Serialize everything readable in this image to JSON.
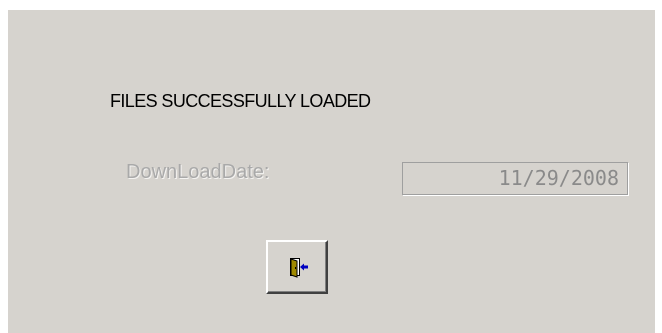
{
  "dialog": {
    "status_message": "FILES SUCCESSFULLY LOADED",
    "download_date_label": "DownLoadDate:",
    "download_date_value": "11/29/2008",
    "exit_icon": "exit-door-icon",
    "colors": {
      "panel_background": "#d6d3ce",
      "disabled_text": "#a9a9a9",
      "door": "#a08a00",
      "arrow": "#0000c0"
    }
  }
}
